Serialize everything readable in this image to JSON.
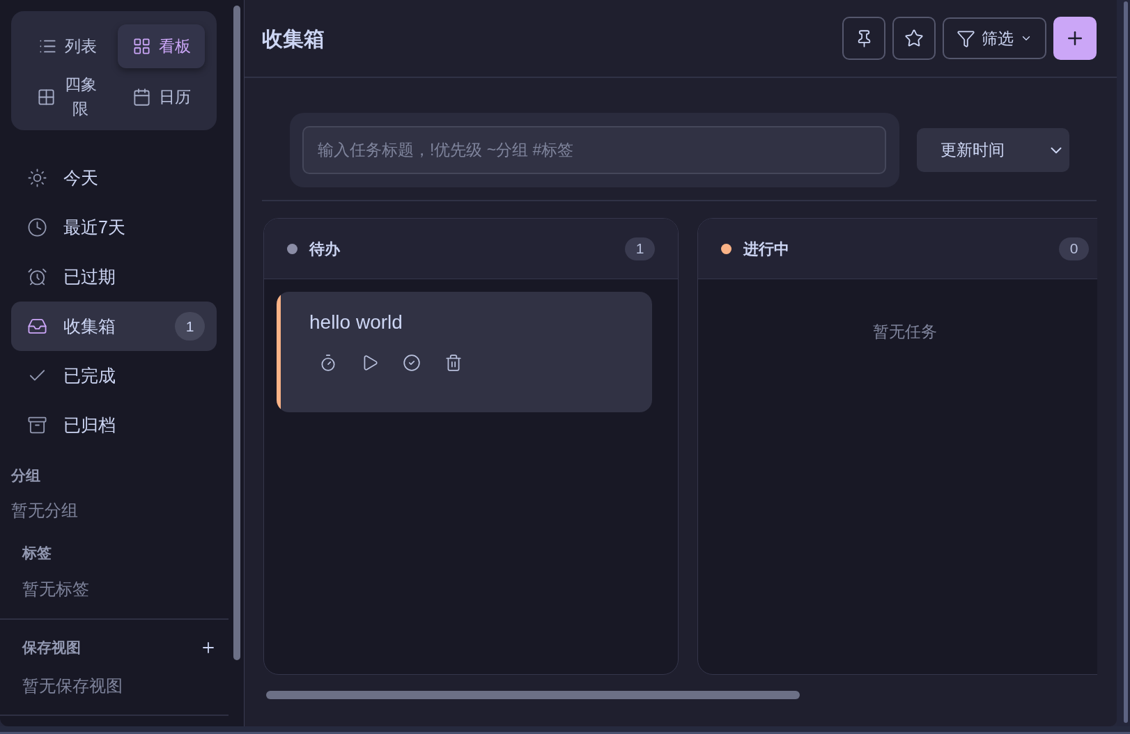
{
  "sidebar": {
    "views": [
      {
        "label": "列表",
        "selected": false
      },
      {
        "label": "看板",
        "selected": true
      },
      {
        "label": "四象限",
        "selected": false
      },
      {
        "label": "日历",
        "selected": false
      }
    ],
    "nav": [
      {
        "label": "今天",
        "selected": false
      },
      {
        "label": "最近7天",
        "selected": false
      },
      {
        "label": "已过期",
        "selected": false
      },
      {
        "label": "收集箱",
        "selected": true,
        "count": "1"
      },
      {
        "label": "已完成",
        "selected": false
      },
      {
        "label": "已归档",
        "selected": false
      }
    ],
    "groups": {
      "title": "分组",
      "empty_text": "暂无分组"
    },
    "tags": {
      "title": "标签",
      "empty_text": "暂无标签"
    },
    "saved_views": {
      "title": "保存视图",
      "empty_text": "暂无保存视图"
    }
  },
  "header": {
    "title": "收集箱",
    "filter": {
      "label": "筛选"
    }
  },
  "quick_add": {
    "placeholder": "输入任务标题，!优先级 ~分组 #标签"
  },
  "sort": {
    "value": "更新时间"
  },
  "columns": [
    {
      "title": "待办",
      "color": "#8b8da6",
      "count": "1",
      "tasks": [
        {
          "title": "hello world",
          "color": "#fab387"
        }
      ]
    },
    {
      "title": "进行中",
      "color": "#fab387",
      "count": "0",
      "empty_text": "暂无任务"
    }
  ]
}
